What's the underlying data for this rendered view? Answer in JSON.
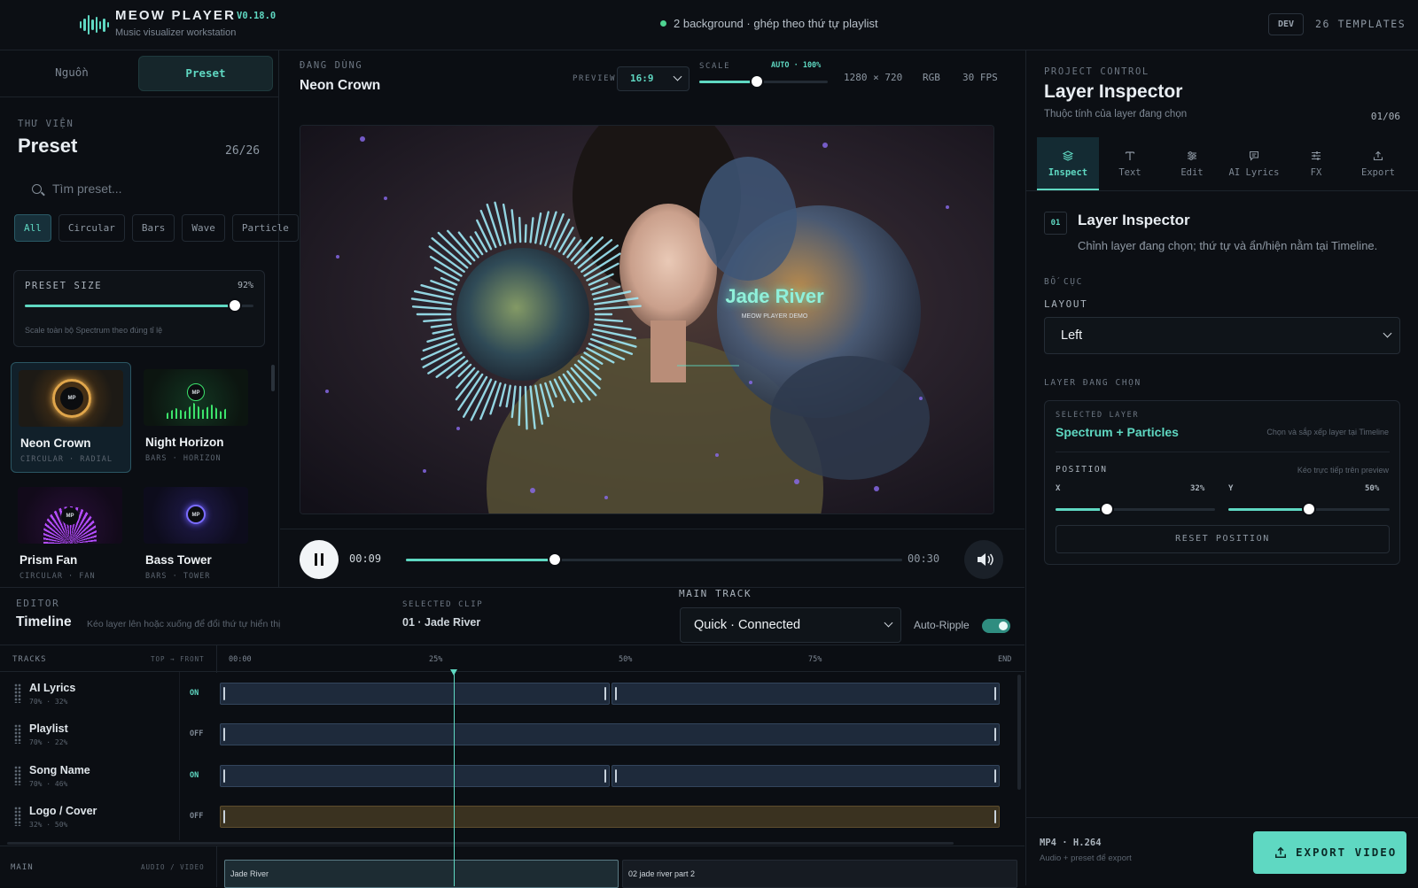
{
  "header": {
    "title": "MEOW PLAYER",
    "version": "V0.18.0",
    "subtitle": "Music visualizer workstation",
    "status": "2 background · ghép theo thứ tự playlist",
    "env_badge": "DEV",
    "templates": "26 TEMPLATES"
  },
  "left": {
    "tabs": [
      "Nguồn",
      "Preset"
    ],
    "library_kicker": "THƯ VIỆN",
    "library_title": "Preset",
    "library_count": "26/26",
    "search_placeholder": "Tìm preset...",
    "filters": [
      "All",
      "Circular",
      "Bars",
      "Wave",
      "Particle"
    ],
    "preset_size": {
      "label": "PRESET SIZE",
      "value_text": "92%",
      "value": 0.92,
      "hint": "Scale toàn bộ Spectrum theo đúng tỉ lệ"
    },
    "presets": [
      {
        "name": "Neon Crown",
        "meta": "CIRCULAR · RADIAL",
        "badge": "MP"
      },
      {
        "name": "Night Horizon",
        "meta": "BARS · HORIZON",
        "badge": "MP"
      },
      {
        "name": "Prism Fan",
        "meta": "CIRCULAR · FAN",
        "badge": "MP"
      },
      {
        "name": "Bass Tower",
        "meta": "BARS · TOWER",
        "badge": "MP"
      }
    ]
  },
  "center": {
    "now_kicker": "ĐANG DÙNG",
    "now_title": "Neon Crown",
    "preview_label": "PREVIEW",
    "aspect": "16:9",
    "scale_label": "SCALE",
    "scale_auto": "AUTO · 100%",
    "scale_value": 0.45,
    "resolution": "1280 × 720",
    "color_mode": "RGB",
    "fps": "30 FPS",
    "overlay_title": "Jade River",
    "overlay_sub": "MEOW PLAYER DEMO",
    "time_current": "00:09",
    "time_total": "00:30",
    "progress": 0.3
  },
  "right": {
    "kicker": "PROJECT CONTROL",
    "title": "Layer Inspector",
    "subtitle": "Thuộc tính của layer đang chọn",
    "page": "01/06",
    "tabs": [
      "Inspect",
      "Text",
      "Edit",
      "AI Lyrics",
      "FX",
      "Export"
    ],
    "section_num": "01",
    "section_title": "Layer Inspector",
    "section_desc": "Chỉnh layer đang chọn; thứ tự và ẩn/hiện nằm tại Timeline.",
    "bocuc_kicker": "BỐ CỤC",
    "layout_label": "LAYOUT",
    "layout_value": "Left",
    "layer_kicker": "LAYER ĐANG CHỌN",
    "selected_kicker": "SELECTED LAYER",
    "selected_name": "Spectrum + Particles",
    "selected_hint": "Chọn và sắp xếp layer tại Timeline",
    "position_label": "POSITION",
    "position_hint": "Kéo trực tiếp trên preview",
    "x_label": "X",
    "x_text": "32%",
    "x_value": 0.32,
    "y_label": "Y",
    "y_text": "50%",
    "y_value": 0.5,
    "reset_label": "RESET POSITION",
    "export_format": "MP4 · H.264",
    "export_desc": "Audio + preset để export",
    "export_button": "EXPORT VIDEO"
  },
  "timeline": {
    "kicker": "EDITOR",
    "title": "Timeline",
    "hint": "Kéo layer lên hoặc xuống để đổi thứ tự hiển thị",
    "clip_kicker": "SELECTED CLIP",
    "clip_value": "01 · Jade River",
    "main_kicker": "MAIN TRACK",
    "main_value": "Quick · Connected",
    "ripple_label": "Auto-Ripple",
    "tracks_label": "TRACKS",
    "order_label": "TOP → FRONT",
    "ruler": [
      "00:00",
      "25%",
      "50%",
      "75%",
      "END"
    ],
    "playhead": 0.3,
    "rows": [
      {
        "name": "AI Lyrics",
        "meta": "70% · 32%",
        "state": "ON"
      },
      {
        "name": "Playlist",
        "meta": "70% · 22%",
        "state": "OFF"
      },
      {
        "name": "Song Name",
        "meta": "70% · 46%",
        "state": "ON"
      },
      {
        "name": "Logo / Cover",
        "meta": "32% · 50%",
        "state": "OFF"
      }
    ],
    "main_label": "MAIN",
    "main_type": "AUDIO / VIDEO",
    "main_clips": [
      "Jade River",
      "02 jade river part 2"
    ]
  },
  "colors": {
    "accent": "#5fd8c2",
    "bg": "#0b0e13",
    "gold": "#e0a64b"
  }
}
